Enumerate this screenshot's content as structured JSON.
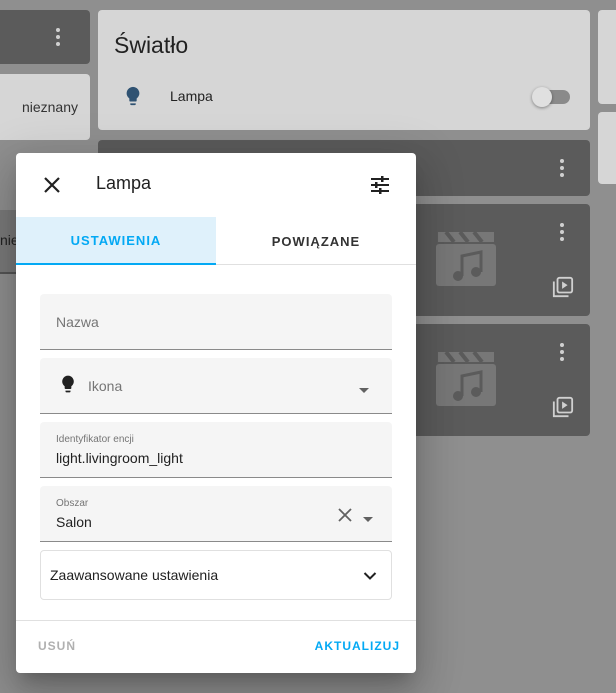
{
  "background": {
    "left_card_status": "nieznany",
    "left_partial_text": "nie",
    "light_card": {
      "title": "Światło",
      "entity_name": "Lampa",
      "icon": "lightbulb-icon"
    }
  },
  "dialog": {
    "title": "Lampa",
    "tabs": [
      {
        "label": "USTAWIENIA",
        "active": true
      },
      {
        "label": "POWIĄZANE",
        "active": false
      }
    ],
    "fields": {
      "name": {
        "placeholder": "Nazwa",
        "value": ""
      },
      "icon": {
        "placeholder": "Ikona",
        "value": ""
      },
      "entity_id": {
        "label": "Identyfikator encji",
        "value": "light.livingroom_light"
      },
      "area": {
        "label": "Obszar",
        "value": "Salon"
      }
    },
    "advanced": {
      "label": "Zaawansowane ustawienia"
    },
    "buttons": {
      "delete": "USUŃ",
      "update": "AKTUALIZUJ"
    }
  },
  "colors": {
    "accent": "#03a9f4",
    "tab_active_bg": "#dff1fb",
    "overlay": "#8f8f8f"
  }
}
